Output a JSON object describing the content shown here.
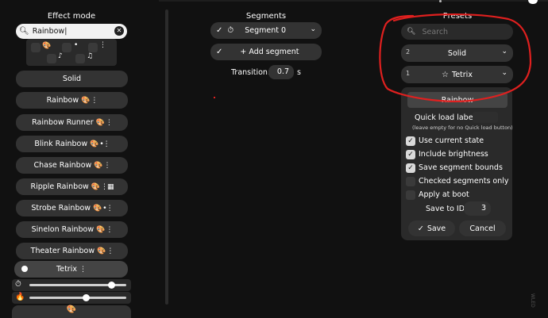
{
  "headers": {
    "effect_mode": "Effect mode",
    "segments": "Segments",
    "presets": "Presets"
  },
  "effect_search": {
    "value": "Rainbow"
  },
  "effects": [
    {
      "label": "Solid"
    },
    {
      "label": "Rainbow"
    },
    {
      "label": "Rainbow Runner"
    },
    {
      "label": "Blink Rainbow"
    },
    {
      "label": "Chase Rainbow"
    },
    {
      "label": "Ripple Rainbow"
    },
    {
      "label": "Strobe Rainbow"
    },
    {
      "label": "Sinelon Rainbow"
    },
    {
      "label": "Theater Rainbow"
    },
    {
      "label": "Tetrix"
    }
  ],
  "segments": {
    "segment0_label": "Segment 0",
    "add_segment_label": "+ Add segment",
    "transition_label": "Transition:",
    "transition_value": "0.7",
    "transition_unit": "s"
  },
  "presets": {
    "search_placeholder": "Search",
    "items": [
      {
        "id": "2",
        "name": "Solid"
      },
      {
        "id": "1",
        "name": "Tetrix"
      }
    ],
    "editor": {
      "name_value": "Rainbow",
      "quick_load_label": "Quick load label:",
      "quick_load_hint": "(leave empty for no Quick load button)",
      "options": [
        {
          "label": "Use current state",
          "checked": true
        },
        {
          "label": "Include brightness",
          "checked": true
        },
        {
          "label": "Save segment bounds",
          "checked": true
        },
        {
          "label": "Checked segments only",
          "checked": false
        },
        {
          "label": "Apply at boot",
          "checked": false
        }
      ],
      "save_to_id_label": "Save to ID",
      "save_to_id_value": "3",
      "save_label": "Save",
      "cancel_label": "Cancel"
    }
  },
  "sliders": {
    "speed": 0.85,
    "intensity": 0.59
  },
  "annotation_color": "#e0201f",
  "accent": "#ffffff"
}
